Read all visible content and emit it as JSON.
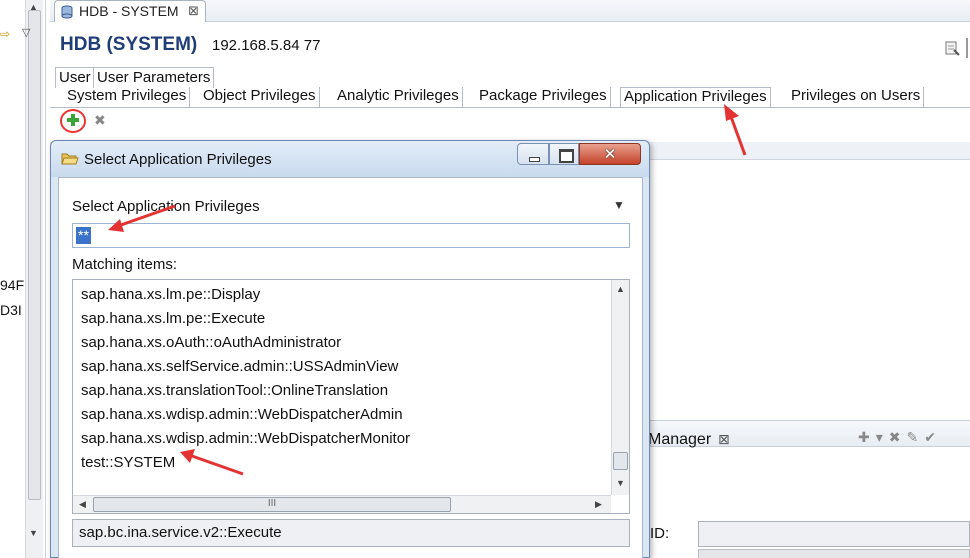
{
  "left_view": {
    "text_top": "94F",
    "text_bottom": "D3I"
  },
  "editor": {
    "tab_label": "HDB - SYSTEM",
    "title": "HDB (SYSTEM)",
    "host": "192.168.5.84 77",
    "top_tabs": [
      "User",
      "User Parameters"
    ],
    "privilege_tabs": [
      "System Privileges",
      "Object Privileges",
      "Analytic Privileges",
      "Package Privileges",
      "Application Privileges",
      "Privileges on Users"
    ],
    "active_privilege_tab": "Application Privileges"
  },
  "lower_view": {
    "tab_label": "Manager",
    "id_label": "ID:"
  },
  "dialog": {
    "title": "Select Application Privileges",
    "section_label": "Select Application Privileges",
    "filter_value": "**",
    "matching_label": "Matching items:",
    "items": [
      "sap.hana.xs.lm.pe::Display",
      "sap.hana.xs.lm.pe::Execute",
      "sap.hana.xs.oAuth::oAuthAdministrator",
      "sap.hana.xs.selfService.admin::USSAdminView",
      "sap.hana.xs.translationTool::OnlineTranslation",
      "sap.hana.xs.wdisp.admin::WebDispatcherAdmin",
      "sap.hana.xs.wdisp.admin::WebDispatcherMonitor",
      "test::SYSTEM"
    ],
    "status_text": "sap.bc.ina.service.v2::Execute"
  },
  "colors": {
    "title_blue": "#1f3d79",
    "selection_blue": "#3a73c9",
    "annotation_red": "#e33333",
    "add_green": "#3aa63a"
  }
}
